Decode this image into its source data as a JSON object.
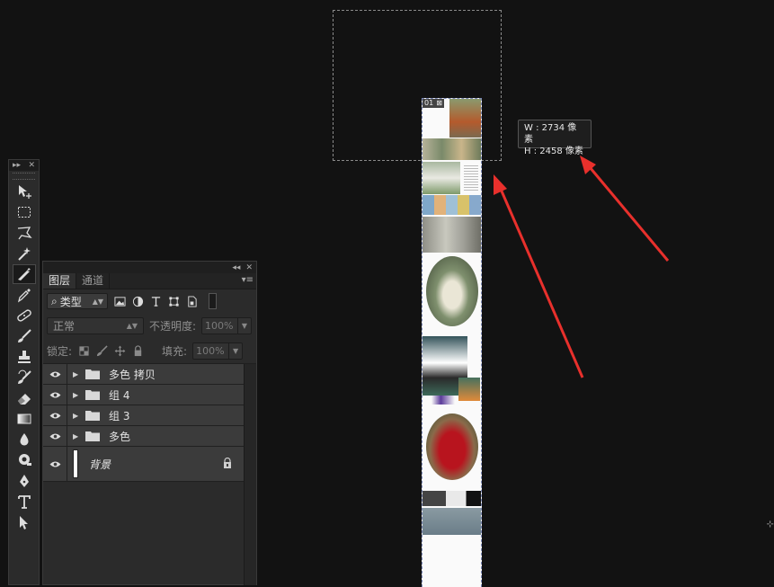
{
  "toolbox": {
    "collapse_glyph": "▸▸",
    "close_glyph": "✕",
    "tools": [
      {
        "name": "move-tool",
        "icon": "move-icon"
      },
      {
        "name": "rect-marquee-tool",
        "icon": "rect-marquee-icon"
      },
      {
        "name": "lasso-tool",
        "icon": "lasso-icon"
      },
      {
        "name": "quick-select-tool",
        "icon": "magic-wand-icon"
      },
      {
        "name": "crop-tool",
        "icon": "slice-icon",
        "active": true
      },
      {
        "name": "eyedropper-tool",
        "icon": "eyedropper-icon"
      },
      {
        "name": "healing-tool",
        "icon": "bandage-icon"
      },
      {
        "name": "brush-tool",
        "icon": "brush-icon"
      },
      {
        "name": "stamp-tool",
        "icon": "stamp-icon"
      },
      {
        "name": "history-brush-tool",
        "icon": "history-brush-icon"
      },
      {
        "name": "eraser-tool",
        "icon": "eraser-icon"
      },
      {
        "name": "gradient-tool",
        "icon": "gradient-icon"
      },
      {
        "name": "blur-tool",
        "icon": "drop-icon"
      },
      {
        "name": "dodge-tool",
        "icon": "dodge-icon"
      },
      {
        "name": "pen-tool",
        "icon": "pen-icon"
      },
      {
        "name": "type-tool",
        "icon": "type-icon"
      },
      {
        "name": "path-select-tool",
        "icon": "arrow-icon"
      }
    ]
  },
  "layers_panel": {
    "collapse_glyph": "◂◂",
    "close_glyph": "✕",
    "tabs": [
      "图层",
      "通道"
    ],
    "active_tab": 0,
    "menu_glyph": "▾≡",
    "filter_kind": "类型",
    "filter_search_glyph": "⌕",
    "blend_mode": "正常",
    "opacity_label": "不透明度:",
    "opacity_value": "100%",
    "lock_label": "锁定:",
    "fill_label": "填充:",
    "fill_value": "100%",
    "layers": [
      {
        "name": "多色 拷贝",
        "type": "group"
      },
      {
        "name": "组 4",
        "type": "group"
      },
      {
        "name": "组 3",
        "type": "group"
      },
      {
        "name": "多色",
        "type": "group"
      }
    ],
    "background_layer": {
      "name": "背景",
      "locked": true
    }
  },
  "canvas": {
    "slice_number": "01",
    "size_readout": {
      "w_line": "W : 2734 像素",
      "h_line": "H : 2458 像素"
    }
  },
  "colors": {
    "arrow": "#e8302c",
    "background": "#121212"
  }
}
